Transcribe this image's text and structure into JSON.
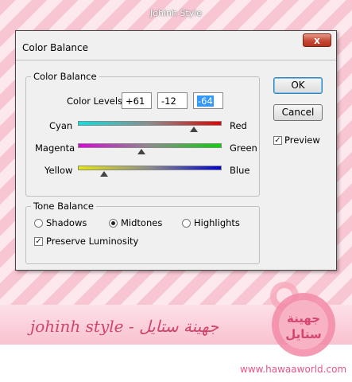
{
  "page": {
    "top_caption": "Johinh Style",
    "banner_text": "johinh style - جهينة ستايل",
    "logo_text": "جهينة ستايل",
    "url": "www.hawaaworld.com"
  },
  "dialog": {
    "title": "Color Balance",
    "close_label": "x",
    "color_balance_group": {
      "legend": "Color Balance",
      "levels_label": "Color Levels:",
      "levels": [
        "+61",
        "-12",
        "-64"
      ],
      "sliders": [
        {
          "left": "Cyan",
          "right": "Red",
          "value": 61
        },
        {
          "left": "Magenta",
          "right": "Green",
          "value": -12
        },
        {
          "left": "Yellow",
          "right": "Blue",
          "value": -64
        }
      ]
    },
    "tone_balance_group": {
      "legend": "Tone Balance",
      "shadows": "Shadows",
      "midtones": "Midtones",
      "highlights": "Highlights",
      "selected": "Midtones",
      "preserve_luminosity": "Preserve Luminosity",
      "preserve_checked": true
    },
    "ok_label": "OK",
    "cancel_label": "Cancel",
    "preview_label": "Preview",
    "preview_checked": true
  },
  "colors": {
    "stripe_pink": "#f8c6d2",
    "banner_text": "#d2456a",
    "url": "#e85585"
  }
}
